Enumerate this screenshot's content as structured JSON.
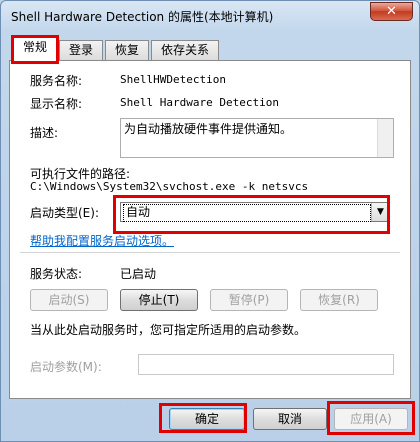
{
  "window": {
    "title": "Shell Hardware Detection 的属性(本地计算机)",
    "close_glyph": "✕"
  },
  "tabs": [
    {
      "label": "常规",
      "active": true
    },
    {
      "label": "登录",
      "active": false
    },
    {
      "label": "恢复",
      "active": false
    },
    {
      "label": "依存关系",
      "active": false
    }
  ],
  "general": {
    "service_name_label": "服务名称:",
    "service_name_value": "ShellHWDetection",
    "display_name_label": "显示名称:",
    "display_name_value": "Shell Hardware Detection",
    "description_label": "描述:",
    "description_value": "为自动播放硬件事件提供通知。",
    "exe_path_label": "可执行文件的路径:",
    "exe_path_value": "C:\\Windows\\System32\\svchost.exe -k netsvcs",
    "startup_type_label": "启动类型(E):",
    "startup_type_value": "自动",
    "help_link": "帮助我配置服务启动选项。",
    "service_status_label": "服务状态:",
    "service_status_value": "已启动",
    "start_btn": "启动(S)",
    "stop_btn": "停止(T)",
    "pause_btn": "暂停(P)",
    "resume_btn": "恢复(R)",
    "hint_text": "当从此处启动服务时，您可指定所适用的启动参数。",
    "start_params_label": "启动参数(M):",
    "start_params_value": ""
  },
  "footer": {
    "ok": "确定",
    "cancel": "取消",
    "apply": "应用(A)"
  },
  "colors": {
    "highlight": "#e00000",
    "link": "#0066cc",
    "disabled_text": "#a0a0a0"
  }
}
